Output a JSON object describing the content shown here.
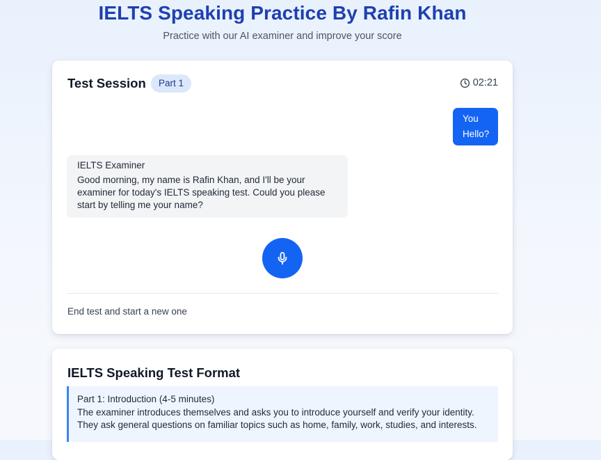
{
  "header": {
    "title": "IELTS Speaking Practice By Rafin Khan",
    "subtitle": "Practice with our AI examiner and improve your score"
  },
  "session": {
    "title": "Test Session",
    "part_badge": "Part 1",
    "timer": "02:21",
    "timer_icon": "clock-icon",
    "messages": {
      "user": {
        "sender": "You",
        "text": "Hello?"
      },
      "examiner": {
        "sender": "IELTS Examiner",
        "text": "Good morning, my name is Rafin Khan, and I'll be your examiner for today's IELTS speaking test. Could you please start by telling me your name?"
      }
    },
    "mic_icon": "microphone-icon",
    "end_test_label": "End test and start a new one"
  },
  "format": {
    "title": "IELTS Speaking Test Format",
    "parts": [
      {
        "title": "Part 1: Introduction (4-5 minutes)",
        "description": "The examiner introduces themselves and asks you to introduce yourself and verify your identity. They ask general questions on familiar topics such as home, family, work, studies, and interests."
      }
    ]
  },
  "colors": {
    "brand_blue": "#1e40af",
    "accent_blue": "#1464f4",
    "badge_bg": "#dbe7fb",
    "examiner_bubble_bg": "#f3f4f6",
    "format_highlight_bg": "#eff5fe",
    "format_border": "#3b82f6"
  }
}
